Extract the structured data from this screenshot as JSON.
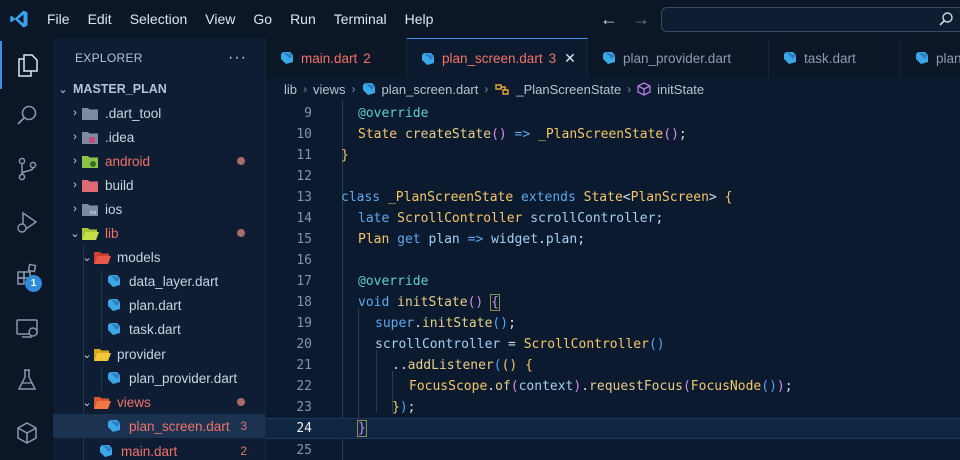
{
  "menu": [
    "File",
    "Edit",
    "Selection",
    "View",
    "Go",
    "Run",
    "Terminal",
    "Help"
  ],
  "nav": {
    "back": "←",
    "forward": "→"
  },
  "activity": {
    "extensions_badge": "1"
  },
  "explorer": {
    "title": "EXPLORER",
    "more": "···",
    "root": "MASTER_PLAN",
    "items": [
      {
        "label": ".dart_tool"
      },
      {
        "label": ".idea"
      },
      {
        "label": "android"
      },
      {
        "label": "build"
      },
      {
        "label": "ios"
      },
      {
        "label": "lib"
      },
      {
        "label": "models"
      },
      {
        "label": "data_layer.dart"
      },
      {
        "label": "plan.dart"
      },
      {
        "label": "task.dart"
      },
      {
        "label": "provider"
      },
      {
        "label": "plan_provider.dart"
      },
      {
        "label": "views"
      },
      {
        "label": "plan_screen.dart",
        "count": "3"
      },
      {
        "label": "main.dart",
        "count": "2"
      }
    ]
  },
  "tabs": [
    {
      "label": "main.dart",
      "count": "2"
    },
    {
      "label": "plan_screen.dart",
      "count": "3",
      "close": "✕"
    },
    {
      "label": "plan_provider.dart"
    },
    {
      "label": "task.dart"
    },
    {
      "label": "plan"
    }
  ],
  "breadcrumb": [
    "lib",
    "views",
    "plan_screen.dart",
    "_PlanScreenState",
    "initState"
  ],
  "editor": {
    "line_numbers": [
      "9",
      "10",
      "11",
      "12",
      "13",
      "14",
      "15",
      "16",
      "17",
      "18",
      "19",
      "20",
      "21",
      "22",
      "23",
      "24",
      "25"
    ],
    "current_line": "24"
  }
}
